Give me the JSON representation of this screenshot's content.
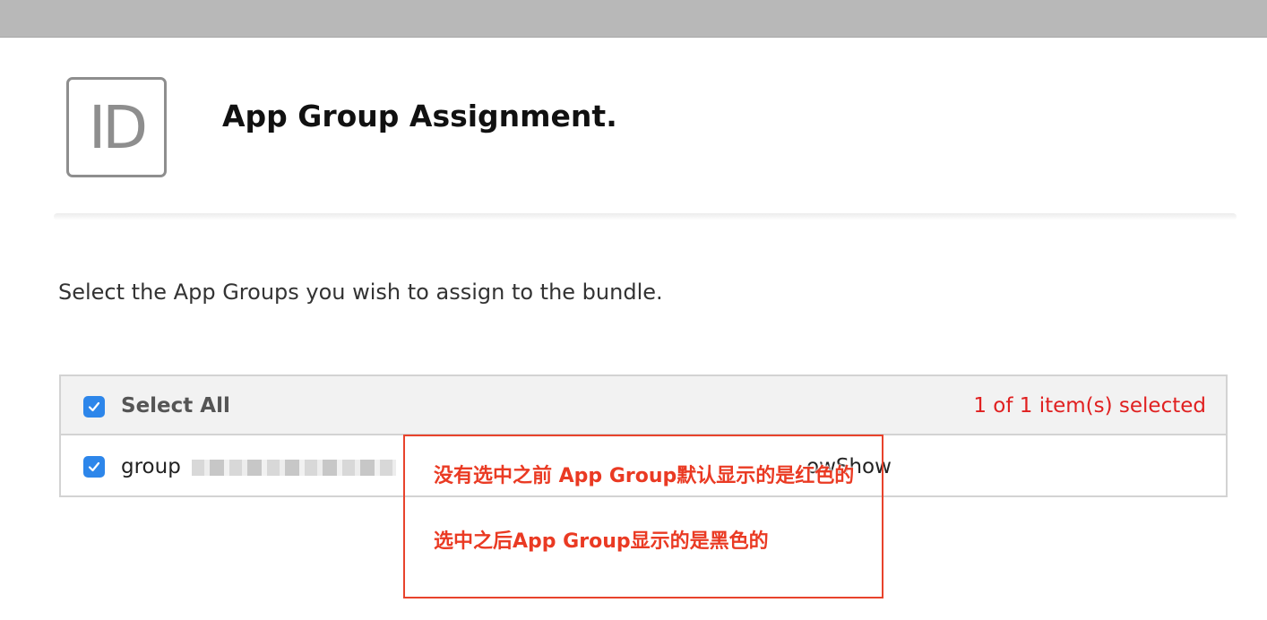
{
  "header": {
    "icon_text": "ID",
    "title": "App Group Assignment."
  },
  "instruction": "Select the App Groups you wish to assign to the bundle.",
  "table": {
    "select_all_label": "Select All",
    "select_all_checked": true,
    "selected_count": "1 of 1 item(s) selected",
    "rows": [
      {
        "checked": true,
        "prefix": "group",
        "suffix": "owShow"
      }
    ]
  },
  "annotations": {
    "note1": "没有选中之前 App Group默认显示的是红色的",
    "note2": "选中之后App Group显示的是黑色的"
  },
  "colors": {
    "accent_checkbox": "#2d86ea",
    "selected_count_text": "#e02020",
    "annotation_red": "#ea3a23",
    "topbar": "#b8b8b8"
  }
}
